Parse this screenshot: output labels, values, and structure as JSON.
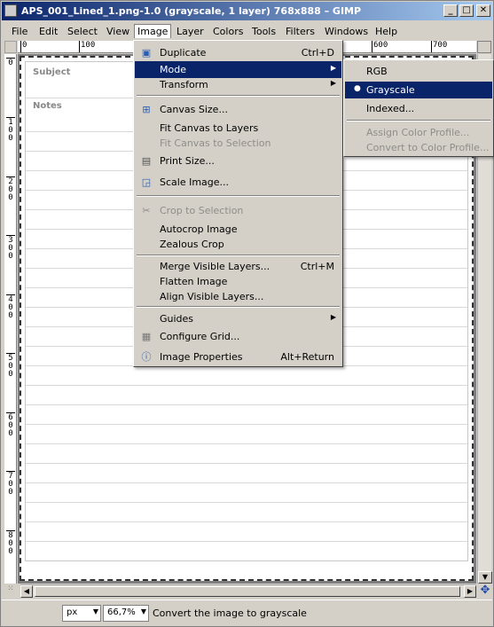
{
  "window": {
    "title": "APS_001_Lined_1.png-1.0 (grayscale, 1 layer) 768x888 – GIMP",
    "minimize": "_",
    "maximize": "□",
    "close": "✕"
  },
  "menubar": {
    "items": [
      {
        "label": "File"
      },
      {
        "label": "Edit"
      },
      {
        "label": "Select"
      },
      {
        "label": "View"
      },
      {
        "label": "Image"
      },
      {
        "label": "Layer"
      },
      {
        "label": "Colors"
      },
      {
        "label": "Tools"
      },
      {
        "label": "Filters"
      },
      {
        "label": "Windows"
      },
      {
        "label": "Help"
      }
    ],
    "active": "Image"
  },
  "ruler": {
    "h_ticks": [
      "0",
      "100",
      "600",
      "700"
    ],
    "v_ticks": [
      "0",
      "100",
      "200",
      "300",
      "400",
      "500",
      "600",
      "700",
      "800"
    ]
  },
  "page": {
    "subject_label": "Subject",
    "notes_label": "Notes"
  },
  "image_menu": {
    "items": [
      {
        "label": "Duplicate",
        "accel": "Ctrl+D",
        "icon": "duplicate-icon",
        "glyph": "▣"
      },
      {
        "label": "Mode",
        "submenu": true,
        "highlighted": true
      },
      {
        "label": "Transform",
        "submenu": true
      },
      {
        "label": "Canvas Size...",
        "icon": "canvas-size-icon",
        "glyph": "⊞"
      },
      {
        "label": "Fit Canvas to Layers"
      },
      {
        "label": "Fit Canvas to Selection",
        "disabled": true
      },
      {
        "label": "Print Size...",
        "icon": "print-size-icon",
        "glyph": "▤"
      },
      {
        "label": "Scale Image...",
        "icon": "scale-image-icon",
        "glyph": "◲"
      },
      {
        "label": "Crop to Selection",
        "disabled": true,
        "icon": "crop-icon",
        "glyph": "✂"
      },
      {
        "label": "Autocrop Image"
      },
      {
        "label": "Zealous Crop"
      },
      {
        "label": "Merge Visible Layers...",
        "accel": "Ctrl+M"
      },
      {
        "label": "Flatten Image"
      },
      {
        "label": "Align Visible Layers..."
      },
      {
        "label": "Guides",
        "submenu": true
      },
      {
        "label": "Configure Grid...",
        "icon": "grid-icon",
        "glyph": "▦"
      },
      {
        "label": "Image Properties",
        "accel": "Alt+Return",
        "icon": "info-icon",
        "glyph": "ⓘ"
      }
    ]
  },
  "mode_submenu": {
    "items": [
      {
        "label": "RGB"
      },
      {
        "label": "Grayscale",
        "selected": true,
        "highlighted": true
      },
      {
        "label": "Indexed..."
      },
      {
        "label": "Assign Color Profile...",
        "disabled": true
      },
      {
        "label": "Convert to Color Profile...",
        "disabled": true
      }
    ]
  },
  "statusbar": {
    "unit": "px",
    "zoom": "66,7%",
    "message": "Convert the image to grayscale"
  },
  "colors": {
    "highlight": "#0a246a",
    "menu_bg": "#d4d0c8",
    "disabled_text": "#8f8d88"
  }
}
